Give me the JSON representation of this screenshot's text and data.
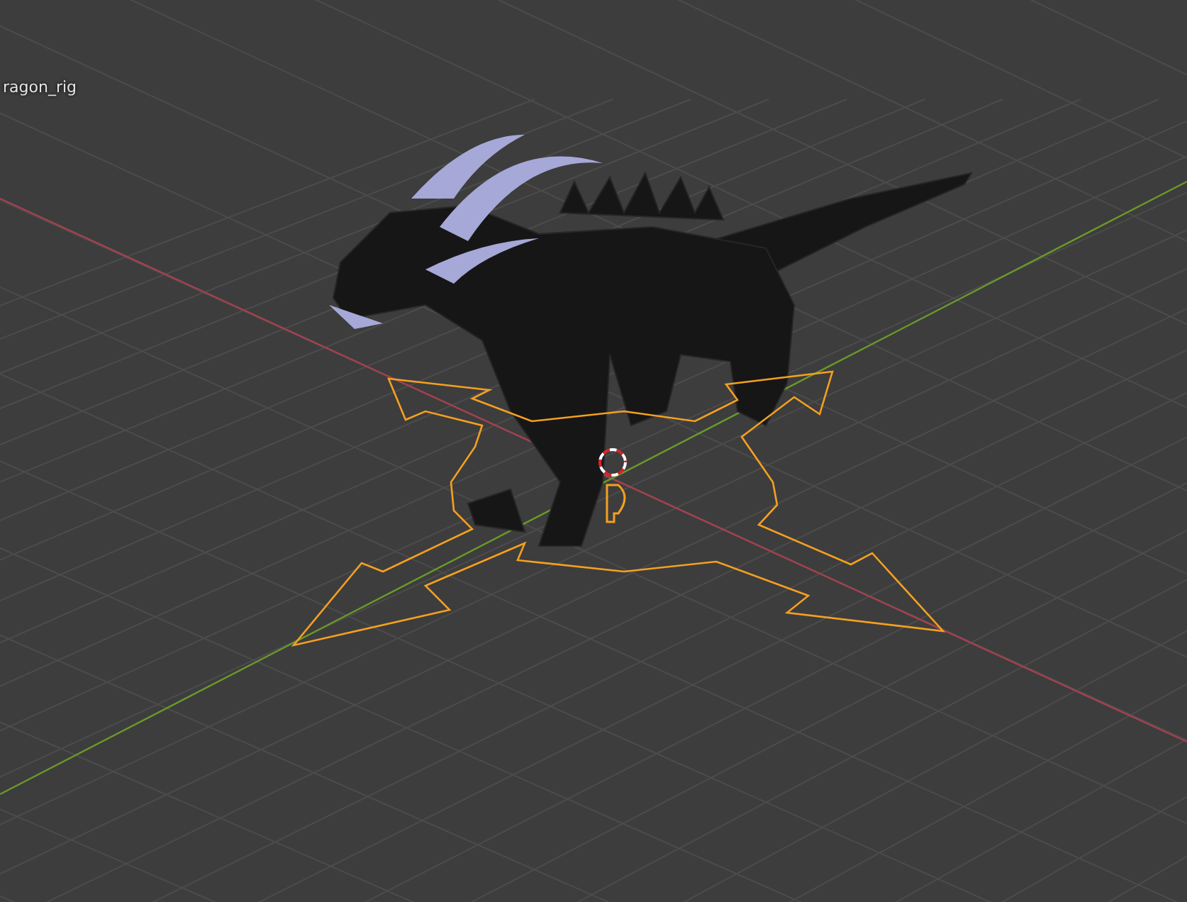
{
  "viewport": {
    "object_label": "ragon_rig"
  }
}
